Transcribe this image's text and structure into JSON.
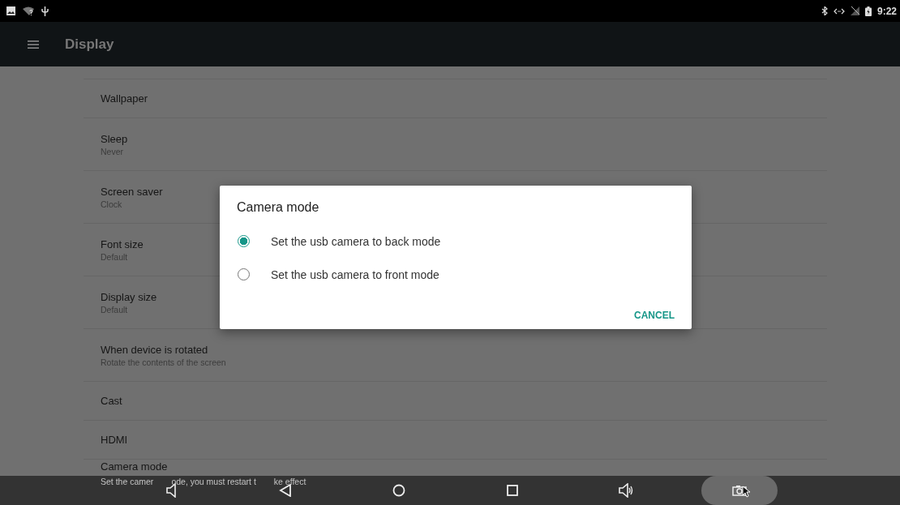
{
  "status_bar": {
    "time": "9:22"
  },
  "toolbar": {
    "title": "Display"
  },
  "settings": [
    {
      "title": "Wallpaper"
    },
    {
      "title": "Sleep",
      "summary": "Never"
    },
    {
      "title": "Screen saver",
      "summary": "Clock"
    },
    {
      "title": "Font size",
      "summary": "Default"
    },
    {
      "title": "Display size",
      "summary": "Default"
    },
    {
      "title": "When device is rotated",
      "summary": "Rotate the contents of the screen"
    },
    {
      "title": "Cast"
    },
    {
      "title": "HDMI"
    },
    {
      "title": "Camera mode",
      "summary_fragments": [
        "Set the camer",
        "ode, you must restart t",
        "ke effect"
      ]
    }
  ],
  "dialog": {
    "title": "Camera mode",
    "options": [
      {
        "label": "Set the usb camera to back mode",
        "selected": true
      },
      {
        "label": "Set the usb camera to front mode",
        "selected": false
      }
    ],
    "buttons": [
      "CANCEL"
    ]
  },
  "nav_buttons": [
    {
      "kind": "volume-down",
      "highlighted": false
    },
    {
      "kind": "back",
      "highlighted": false
    },
    {
      "kind": "home",
      "highlighted": false
    },
    {
      "kind": "recents",
      "highlighted": false
    },
    {
      "kind": "volume-up",
      "highlighted": false
    },
    {
      "kind": "screenshot",
      "highlighted": true
    }
  ]
}
